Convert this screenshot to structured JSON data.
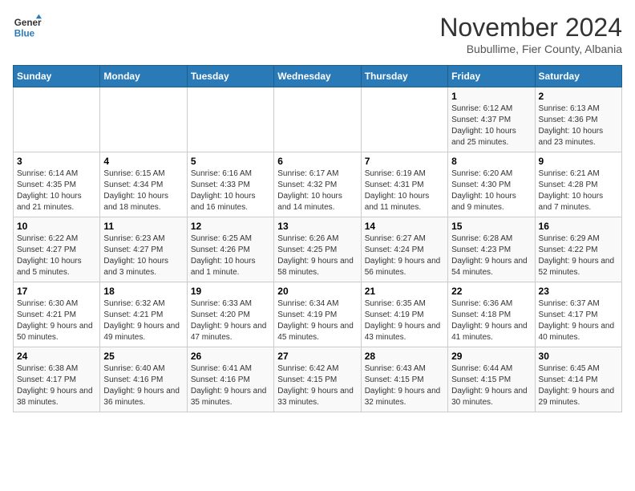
{
  "logo": {
    "line1": "General",
    "line2": "Blue"
  },
  "title": "November 2024",
  "subtitle": "Bubullime, Fier County, Albania",
  "days_of_week": [
    "Sunday",
    "Monday",
    "Tuesday",
    "Wednesday",
    "Thursday",
    "Friday",
    "Saturday"
  ],
  "weeks": [
    [
      {
        "day": "",
        "info": ""
      },
      {
        "day": "",
        "info": ""
      },
      {
        "day": "",
        "info": ""
      },
      {
        "day": "",
        "info": ""
      },
      {
        "day": "",
        "info": ""
      },
      {
        "day": "1",
        "info": "Sunrise: 6:12 AM\nSunset: 4:37 PM\nDaylight: 10 hours and 25 minutes."
      },
      {
        "day": "2",
        "info": "Sunrise: 6:13 AM\nSunset: 4:36 PM\nDaylight: 10 hours and 23 minutes."
      }
    ],
    [
      {
        "day": "3",
        "info": "Sunrise: 6:14 AM\nSunset: 4:35 PM\nDaylight: 10 hours and 21 minutes."
      },
      {
        "day": "4",
        "info": "Sunrise: 6:15 AM\nSunset: 4:34 PM\nDaylight: 10 hours and 18 minutes."
      },
      {
        "day": "5",
        "info": "Sunrise: 6:16 AM\nSunset: 4:33 PM\nDaylight: 10 hours and 16 minutes."
      },
      {
        "day": "6",
        "info": "Sunrise: 6:17 AM\nSunset: 4:32 PM\nDaylight: 10 hours and 14 minutes."
      },
      {
        "day": "7",
        "info": "Sunrise: 6:19 AM\nSunset: 4:31 PM\nDaylight: 10 hours and 11 minutes."
      },
      {
        "day": "8",
        "info": "Sunrise: 6:20 AM\nSunset: 4:30 PM\nDaylight: 10 hours and 9 minutes."
      },
      {
        "day": "9",
        "info": "Sunrise: 6:21 AM\nSunset: 4:28 PM\nDaylight: 10 hours and 7 minutes."
      }
    ],
    [
      {
        "day": "10",
        "info": "Sunrise: 6:22 AM\nSunset: 4:27 PM\nDaylight: 10 hours and 5 minutes."
      },
      {
        "day": "11",
        "info": "Sunrise: 6:23 AM\nSunset: 4:27 PM\nDaylight: 10 hours and 3 minutes."
      },
      {
        "day": "12",
        "info": "Sunrise: 6:25 AM\nSunset: 4:26 PM\nDaylight: 10 hours and 1 minute."
      },
      {
        "day": "13",
        "info": "Sunrise: 6:26 AM\nSunset: 4:25 PM\nDaylight: 9 hours and 58 minutes."
      },
      {
        "day": "14",
        "info": "Sunrise: 6:27 AM\nSunset: 4:24 PM\nDaylight: 9 hours and 56 minutes."
      },
      {
        "day": "15",
        "info": "Sunrise: 6:28 AM\nSunset: 4:23 PM\nDaylight: 9 hours and 54 minutes."
      },
      {
        "day": "16",
        "info": "Sunrise: 6:29 AM\nSunset: 4:22 PM\nDaylight: 9 hours and 52 minutes."
      }
    ],
    [
      {
        "day": "17",
        "info": "Sunrise: 6:30 AM\nSunset: 4:21 PM\nDaylight: 9 hours and 50 minutes."
      },
      {
        "day": "18",
        "info": "Sunrise: 6:32 AM\nSunset: 4:21 PM\nDaylight: 9 hours and 49 minutes."
      },
      {
        "day": "19",
        "info": "Sunrise: 6:33 AM\nSunset: 4:20 PM\nDaylight: 9 hours and 47 minutes."
      },
      {
        "day": "20",
        "info": "Sunrise: 6:34 AM\nSunset: 4:19 PM\nDaylight: 9 hours and 45 minutes."
      },
      {
        "day": "21",
        "info": "Sunrise: 6:35 AM\nSunset: 4:19 PM\nDaylight: 9 hours and 43 minutes."
      },
      {
        "day": "22",
        "info": "Sunrise: 6:36 AM\nSunset: 4:18 PM\nDaylight: 9 hours and 41 minutes."
      },
      {
        "day": "23",
        "info": "Sunrise: 6:37 AM\nSunset: 4:17 PM\nDaylight: 9 hours and 40 minutes."
      }
    ],
    [
      {
        "day": "24",
        "info": "Sunrise: 6:38 AM\nSunset: 4:17 PM\nDaylight: 9 hours and 38 minutes."
      },
      {
        "day": "25",
        "info": "Sunrise: 6:40 AM\nSunset: 4:16 PM\nDaylight: 9 hours and 36 minutes."
      },
      {
        "day": "26",
        "info": "Sunrise: 6:41 AM\nSunset: 4:16 PM\nDaylight: 9 hours and 35 minutes."
      },
      {
        "day": "27",
        "info": "Sunrise: 6:42 AM\nSunset: 4:15 PM\nDaylight: 9 hours and 33 minutes."
      },
      {
        "day": "28",
        "info": "Sunrise: 6:43 AM\nSunset: 4:15 PM\nDaylight: 9 hours and 32 minutes."
      },
      {
        "day": "29",
        "info": "Sunrise: 6:44 AM\nSunset: 4:15 PM\nDaylight: 9 hours and 30 minutes."
      },
      {
        "day": "30",
        "info": "Sunrise: 6:45 AM\nSunset: 4:14 PM\nDaylight: 9 hours and 29 minutes."
      }
    ]
  ]
}
